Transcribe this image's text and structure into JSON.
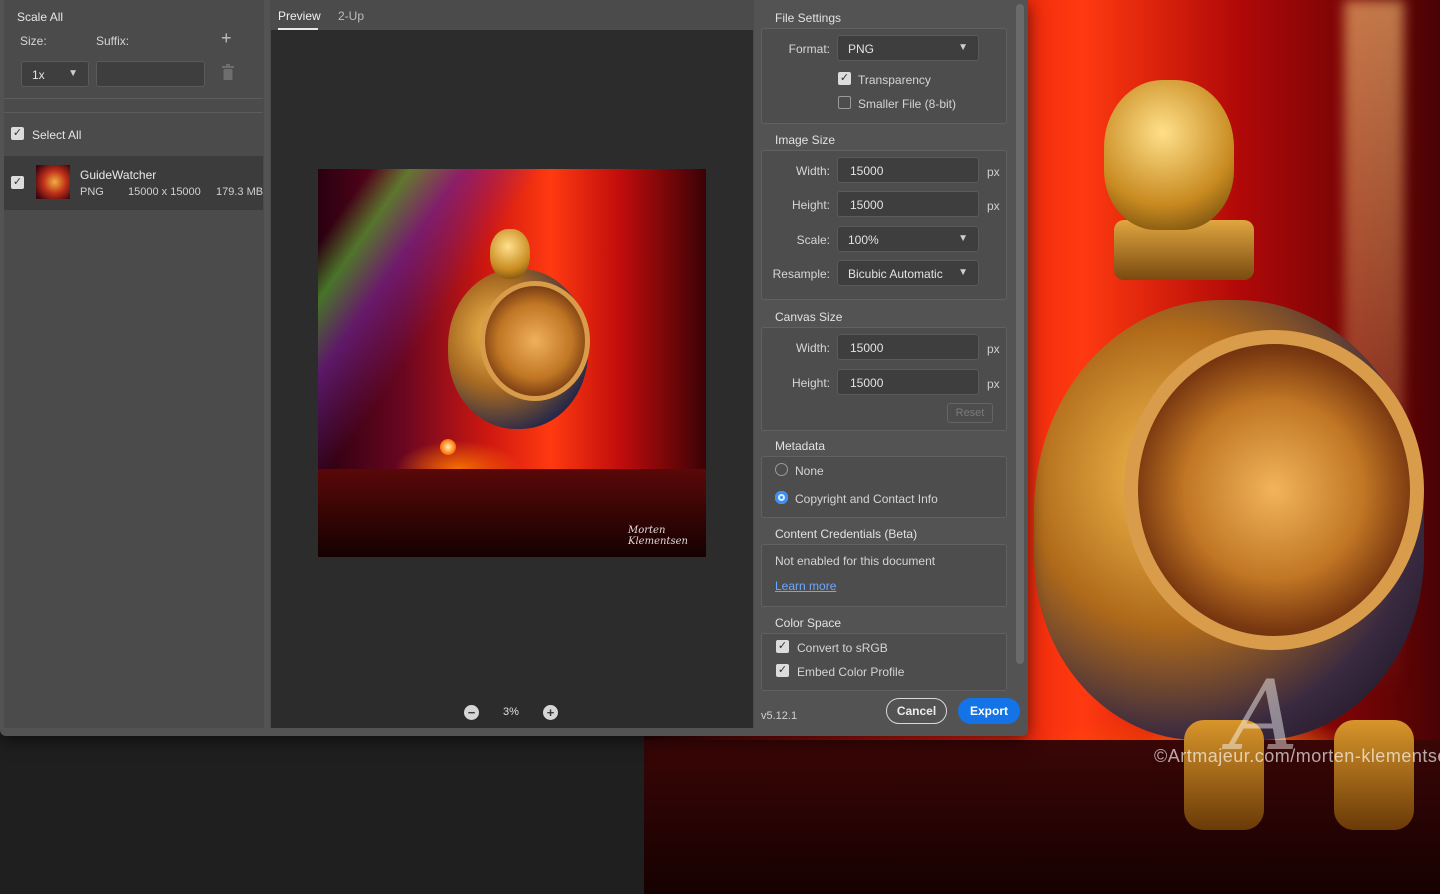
{
  "background": {
    "watermark": "©Artmajeur.com/morten-klementsen",
    "logo_letter": "A"
  },
  "left": {
    "scale_all": "Scale All",
    "size_label": "Size:",
    "suffix_label": "Suffix:",
    "size_value": "1x",
    "suffix_value": "",
    "add_icon": "plus-icon",
    "delete_icon": "trash-icon",
    "select_all": "Select All",
    "file": {
      "name": "GuideWatcher",
      "format": "PNG",
      "dimensions": "15000 x 15000",
      "size": "179.3 MB"
    }
  },
  "center": {
    "tabs": [
      "Preview",
      "2-Up"
    ],
    "active_tab": "Preview",
    "zoom": "3%",
    "signature": "Morten Klementsen"
  },
  "right": {
    "file_settings": {
      "title": "File Settings",
      "format_label": "Format:",
      "format_value": "PNG",
      "transparency_label": "Transparency",
      "transparency_checked": true,
      "smaller_label": "Smaller File (8-bit)",
      "smaller_checked": false
    },
    "image_size": {
      "title": "Image Size",
      "width_label": "Width:",
      "width_value": "15000",
      "height_label": "Height:",
      "height_value": "15000",
      "scale_label": "Scale:",
      "scale_value": "100%",
      "resample_label": "Resample:",
      "resample_value": "Bicubic Automatic",
      "unit": "px"
    },
    "canvas_size": {
      "title": "Canvas Size",
      "width_label": "Width:",
      "width_value": "15000",
      "height_label": "Height:",
      "height_value": "15000",
      "unit": "px",
      "reset_label": "Reset"
    },
    "metadata": {
      "title": "Metadata",
      "option_none": "None",
      "option_copyright": "Copyright and Contact Info",
      "selected": "Copyright and Contact Info"
    },
    "content_credentials": {
      "title": "Content Credentials (Beta)",
      "status": "Not enabled for this document",
      "link": "Learn more"
    },
    "color_space": {
      "title": "Color Space",
      "convert_label": "Convert to sRGB",
      "convert_checked": true,
      "embed_label": "Embed Color Profile",
      "embed_checked": true
    },
    "version": "v5.12.1",
    "cancel": "Cancel",
    "export": "Export"
  },
  "colors": {
    "accent": "#1473e6",
    "panel": "#4b4b4b",
    "dialog": "#535353"
  }
}
